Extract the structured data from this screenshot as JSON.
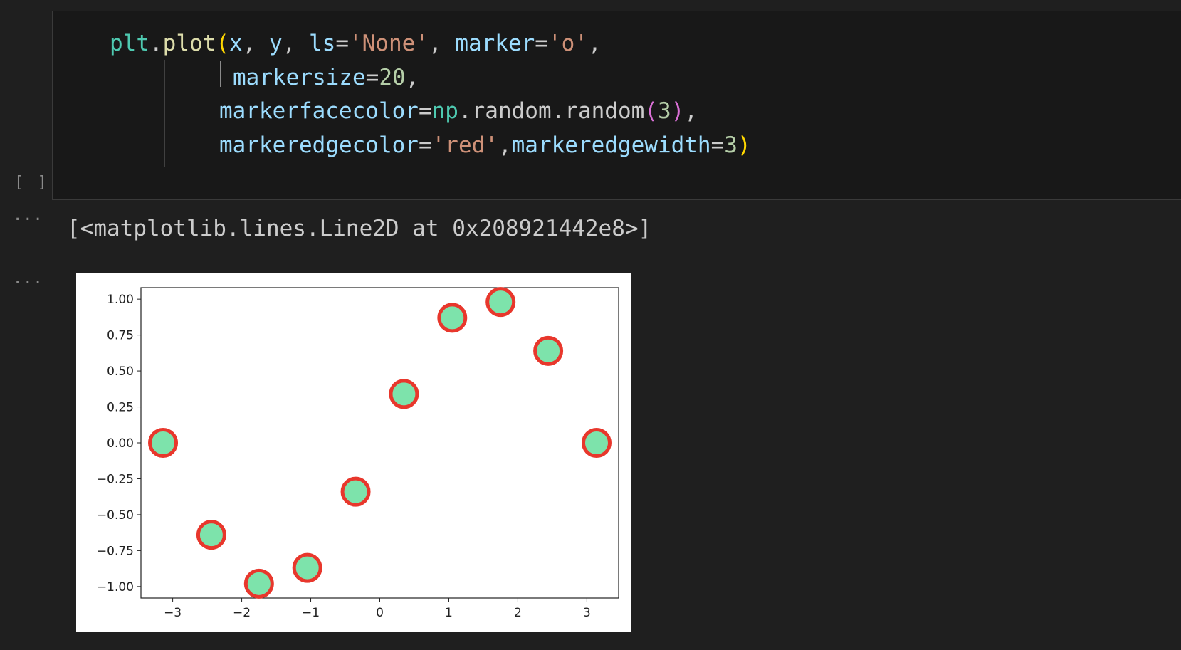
{
  "code_cell": {
    "lines": [
      [
        {
          "t": "plt",
          "c": "fn"
        },
        {
          "t": ".",
          "c": "op"
        },
        {
          "t": "plot",
          "c": "call"
        },
        {
          "t": "(",
          "c": "p1"
        },
        {
          "t": "x",
          "c": "var"
        },
        {
          "t": ", ",
          "c": "op"
        },
        {
          "t": "y",
          "c": "var"
        },
        {
          "t": ", ",
          "c": "op"
        },
        {
          "t": "ls",
          "c": "var"
        },
        {
          "t": "=",
          "c": "op"
        },
        {
          "t": "'None'",
          "c": "str"
        },
        {
          "t": ", ",
          "c": "op"
        },
        {
          "t": "marker",
          "c": "var"
        },
        {
          "t": "=",
          "c": "op"
        },
        {
          "t": "'o'",
          "c": "str"
        },
        {
          "t": ",",
          "c": "op"
        }
      ],
      [
        {
          "t": "markersize",
          "c": "var"
        },
        {
          "t": "=",
          "c": "op"
        },
        {
          "t": "20",
          "c": "num"
        },
        {
          "t": ",",
          "c": "op"
        }
      ],
      [
        {
          "t": "markerfacecolor",
          "c": "var"
        },
        {
          "t": "=",
          "c": "op"
        },
        {
          "t": "np",
          "c": "fn"
        },
        {
          "t": ".",
          "c": "op"
        },
        {
          "t": "random",
          "c": "op"
        },
        {
          "t": ".",
          "c": "op"
        },
        {
          "t": "random",
          "c": "op"
        },
        {
          "t": "(",
          "c": "p2"
        },
        {
          "t": "3",
          "c": "num"
        },
        {
          "t": ")",
          "c": "p2"
        },
        {
          "t": ",",
          "c": "op"
        }
      ],
      [
        {
          "t": "markeredgecolor",
          "c": "var"
        },
        {
          "t": "=",
          "c": "op"
        },
        {
          "t": "'red'",
          "c": "str"
        },
        {
          "t": ",",
          "c": "op"
        },
        {
          "t": "markeredgewidth",
          "c": "var"
        },
        {
          "t": "=",
          "c": "op"
        },
        {
          "t": "3",
          "c": "num"
        },
        {
          "t": ")",
          "c": "p1"
        }
      ]
    ],
    "exec_indicator": "[ ]"
  },
  "output": {
    "ellipsis": "···",
    "text": "[<matplotlib.lines.Line2D at 0x208921442e8>]"
  },
  "chart_data": {
    "type": "scatter",
    "x": [
      -3.14,
      -2.44,
      -1.75,
      -1.05,
      -0.35,
      0.35,
      1.05,
      1.75,
      2.44,
      3.14
    ],
    "y": [
      0.0,
      -0.64,
      -0.98,
      -0.87,
      -0.34,
      0.34,
      0.87,
      0.98,
      0.64,
      0.0
    ],
    "xlim": [
      -3.46,
      3.46
    ],
    "ylim": [
      -1.08,
      1.08
    ],
    "xticks": [
      {
        "v": -3,
        "label": "−3"
      },
      {
        "v": -2,
        "label": "−2"
      },
      {
        "v": -1,
        "label": "−1"
      },
      {
        "v": 0,
        "label": "0"
      },
      {
        "v": 1,
        "label": "1"
      },
      {
        "v": 2,
        "label": "2"
      },
      {
        "v": 3,
        "label": "3"
      }
    ],
    "yticks": [
      {
        "v": 1.0,
        "label": "1.00"
      },
      {
        "v": 0.75,
        "label": "0.75"
      },
      {
        "v": 0.5,
        "label": "0.50"
      },
      {
        "v": 0.25,
        "label": "0.25"
      },
      {
        "v": 0.0,
        "label": "0.00"
      },
      {
        "v": -0.25,
        "label": "−0.25"
      },
      {
        "v": -0.5,
        "label": "−0.50"
      },
      {
        "v": -0.75,
        "label": "−0.75"
      },
      {
        "v": -1.0,
        "label": "−1.00"
      }
    ],
    "marker_face_color": "#7de3ab",
    "marker_edge_color": "#e8372c",
    "grid": false
  }
}
